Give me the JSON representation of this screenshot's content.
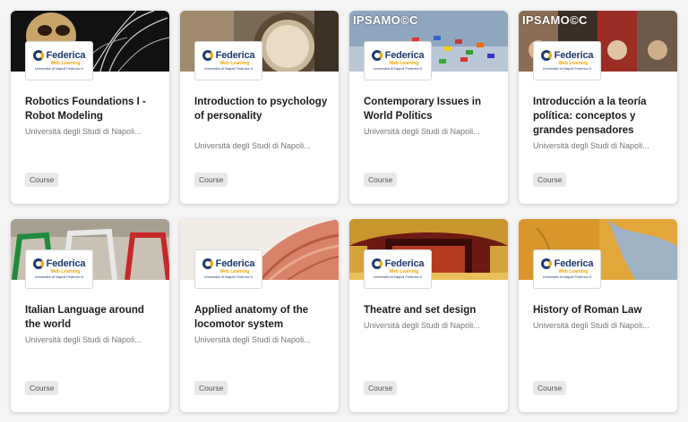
{
  "brand": {
    "name": "Federica",
    "line1": "Web Learning",
    "line2": "Università di Napoli Federico II"
  },
  "overlay_text": "IPSAMO©C",
  "courses": [
    {
      "title": "Robotics Foundations I - Robot Modeling",
      "org": "Università degli Studi di Napoli...",
      "badge": "Course"
    },
    {
      "title": "Introduction to psychology of personality",
      "org": "Università degli Studi di Napoli...",
      "badge": "Course"
    },
    {
      "title": "Contemporary Issues in World Politics",
      "org": "Università degli Studi di Napoli...",
      "badge": "Course"
    },
    {
      "title": "Introducción a la teoría política: conceptos y grandes pensadores",
      "org": "Università degli Studi di Napoli...",
      "badge": "Course"
    },
    {
      "title": "Italian Language around the world",
      "org": "Università degli Studi di Napoli...",
      "badge": "Course"
    },
    {
      "title": "Applied anatomy of the locomotor system",
      "org": "Università degli Studi di Napoli...",
      "badge": "Course"
    },
    {
      "title": "Theatre and set design",
      "org": "Università degli Studi di Napoli...",
      "badge": "Course"
    },
    {
      "title": "History of Roman Law",
      "org": "Università degli Studi di Napoli...",
      "badge": "Course"
    }
  ]
}
